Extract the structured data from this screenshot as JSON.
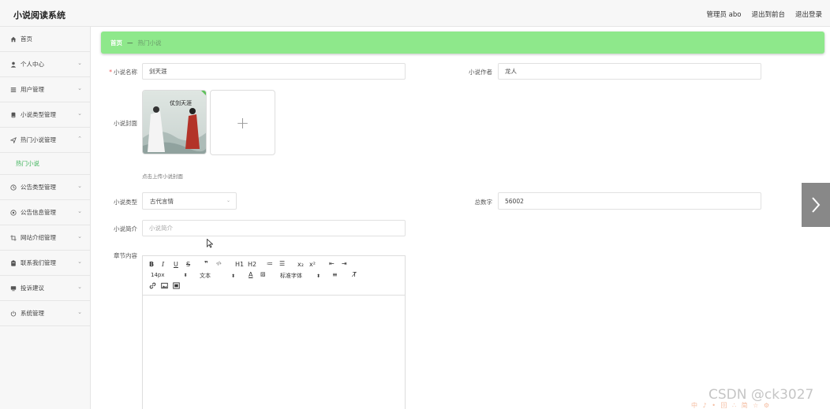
{
  "header": {
    "title": "小说阅读系统",
    "admin_label": "管理员 abo",
    "to_frontend": "退出到前台",
    "logout": "退出登录"
  },
  "sidebar": {
    "items": [
      {
        "label": "首页",
        "icon": "home-icon"
      },
      {
        "label": "个人中心",
        "icon": "user-icon"
      },
      {
        "label": "用户管理",
        "icon": "list-icon"
      },
      {
        "label": "小说类型管理",
        "icon": "book-icon"
      },
      {
        "label": "热门小说管理",
        "icon": "send-icon",
        "expanded": true
      },
      {
        "label": "热门小说",
        "sub": true
      },
      {
        "label": "公告类型管理",
        "icon": "clock-icon"
      },
      {
        "label": "公告信息管理",
        "icon": "circle-icon"
      },
      {
        "label": "网站介绍管理",
        "icon": "crop-icon"
      },
      {
        "label": "联系我们管理",
        "icon": "clipboard-icon"
      },
      {
        "label": "投诉建议",
        "icon": "monitor-icon"
      },
      {
        "label": "系统管理",
        "icon": "power-icon"
      }
    ]
  },
  "breadcrumb": {
    "home": "首页",
    "separator": "—",
    "current": "热门小说"
  },
  "form": {
    "name_label": "小说名称",
    "name_value": "剑天涯",
    "author_label": "小说作者",
    "author_value": "龙人",
    "cover_label": "小说封面",
    "cover_title": "仗剑天涯",
    "upload_hint": "点击上传小说封面",
    "type_label": "小说类型",
    "type_value": "古代言情",
    "words_label": "总数字",
    "words_value": "56002",
    "intro_label": "小说简介",
    "intro_placeholder": "小说简介",
    "chapter_label": "章节内容"
  },
  "editor": {
    "bold": "B",
    "italic": "I",
    "underline": "U",
    "strike": "S",
    "quote": "❞",
    "code": "‹/›",
    "h1": "H1",
    "h2": "H2",
    "ol": "≔",
    "ul": "☰",
    "sub": "x₂",
    "sup": "x²",
    "outdent": "⇤",
    "indent": "⇥",
    "font_size": "14px",
    "text_style": "文本",
    "font_family": "标准字体",
    "clear": "T̸"
  },
  "watermark": "CSDN @ck3027",
  "watermark2": "中 ♪ • 回 ∴ 简 ☆ ⚙",
  "colors": {
    "accent": "#8ee88b",
    "active_sub": "#3db35a"
  }
}
